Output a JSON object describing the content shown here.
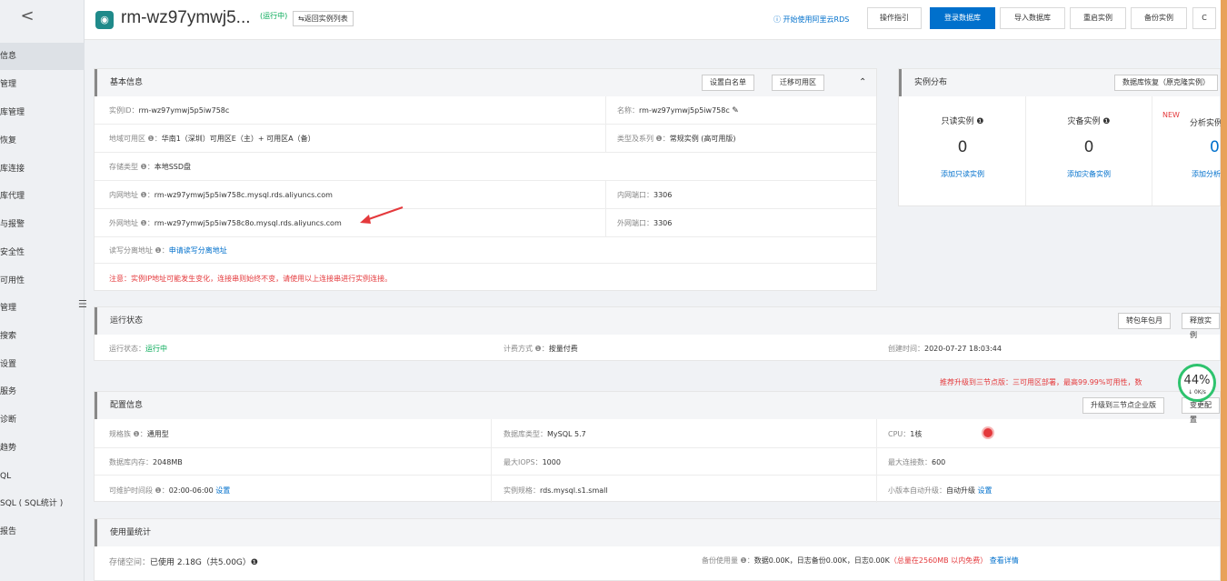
{
  "sidebar": {
    "back": "<",
    "items": [
      "信息",
      "管理",
      "库管理",
      "恢复",
      "库连接",
      "库代理",
      "与报警",
      "安全性",
      "可用性",
      "管理",
      "搜索",
      "设置",
      "服务",
      "诊断",
      "趋势",
      "QL",
      "SQL ( SQL统计 )",
      "报告"
    ],
    "toggle": "☰"
  },
  "header": {
    "title": "rm-wz97ymwj5...",
    "status": "(运行中)",
    "back_btn": "⇆返回实例列表",
    "help_link": "ⓘ 开始使用阿里云RDS",
    "buttons": [
      "操作指引",
      "登录数据库",
      "导入数据库",
      "重启实例",
      "备份实例",
      "C"
    ]
  },
  "basic": {
    "title": "基本信息",
    "buttons": [
      "设置白名单",
      "迁移可用区",
      "⌃"
    ],
    "instance_id_label": "实例ID：",
    "instance_id": "rm-wz97ymwj5p5iw758c",
    "name_label": "名称：",
    "name": "rm-wz97ymwj5p5iw758c",
    "region_label": "地域可用区 ❶：",
    "region": "华南1（深圳）可用区E（主）+ 可用区A（备）",
    "type_label": "类型及系列 ❶：",
    "type": "常规实例 (高可用版)",
    "storage_label": "存储类型 ❶：",
    "storage": "本地SSD盘",
    "intranet_label": "内网地址 ❶：",
    "intranet": "rm-wz97ymwj5p5iw758c.mysql.rds.aliyuncs.com",
    "intranet_port_label": "内网端口：",
    "intranet_port": "3306",
    "extranet_label": "外网地址 ❶：",
    "extranet": "rm-wz97ymwj5p5iw758c8o.mysql.rds.aliyuncs.com",
    "extranet_port_label": "外网端口：",
    "extranet_port": "3306",
    "rw_label": "读写分离地址 ❶：",
    "rw_link": "申请读写分离地址",
    "note": "注意：实例IP地址可能发生变化，连接串则始终不变，请使用以上连接串进行实例连接。"
  },
  "dist": {
    "title": "实例分布",
    "button": "数据库恢复（原克隆实例）",
    "readonly_label": "只读实例 ❶",
    "readonly_count": "0",
    "readonly_link": "添加只读实例",
    "disaster_label": "灾备实例 ❶",
    "disaster_count": "0",
    "disaster_link": "添加灾备实例",
    "new_badge": "NEW",
    "analytic_label": "分析实例",
    "analytic_count": "0",
    "analytic_link": "添加分析"
  },
  "running": {
    "title": "运行状态",
    "buttons": [
      "转包年包月",
      "释放实例"
    ],
    "state_label": "运行状态：",
    "state": "运行中",
    "billing_label": "计费方式 ❶：",
    "billing": "按量付费",
    "created_label": "创建时间：",
    "created": "2020-07-27 18:03:44",
    "promo": "推荐升级到三节点版：三可用区部署，最高99.99%可用性，数"
  },
  "config": {
    "title": "配置信息",
    "buttons": [
      "升级到三节点企业版",
      "变更配置"
    ],
    "spec_label": "规格族 ❶：",
    "spec": "通用型",
    "dbtype_label": "数据库类型：",
    "dbtype": "MySQL 5.7",
    "cpu_label": "CPU：",
    "cpu": "1核",
    "mem_label": "数据库内存：",
    "mem": "2048MB",
    "iops_label": "最大IOPS：",
    "iops": "1000",
    "conn_label": "最大连接数：",
    "conn": "600",
    "maint_label": "可维护时间段 ❶：",
    "maint": "02:00-06:00",
    "maint_link": "设置",
    "class_label": "实例规格：",
    "class": "rds.mysql.s1.small",
    "upgrade_label": "小版本自动升级：",
    "upgrade": "自动升级",
    "upgrade_link": "设置"
  },
  "usage": {
    "title": "使用量统计",
    "storage_label": "存储空间：",
    "storage": "已使用 2.18G（共5.00G）❶",
    "backup_label": "备份使用量 ❶：",
    "backup": "数据0.00K，日志备份0.00K，日志0.00K",
    "backup_free": "（总量在2560MB 以内免费）",
    "backup_link": "查看详情"
  },
  "monitor": {
    "percent": "44%",
    "speed": "↓ 0K/s"
  },
  "colors": {
    "accent": "#0070cc",
    "ok": "#00a854",
    "warn": "#e4393c"
  }
}
